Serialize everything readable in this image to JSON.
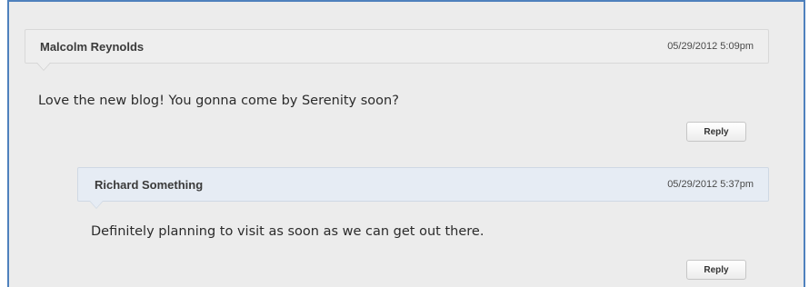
{
  "comments": [
    {
      "author": "Malcolm Reynolds",
      "timestamp": "05/29/2012 5:09pm",
      "body": "Love the new blog! You gonna come by Serenity soon?",
      "reply_label": "Reply"
    },
    {
      "author": "Richard Something",
      "timestamp": "05/29/2012 5:37pm",
      "body": "Definitely planning to visit as soon as we can get out there.",
      "reply_label": "Reply"
    }
  ],
  "colors": {
    "frame_border": "#4f81bd",
    "page_background": "#ececec",
    "reply_header_background": "#e6ecf4"
  }
}
